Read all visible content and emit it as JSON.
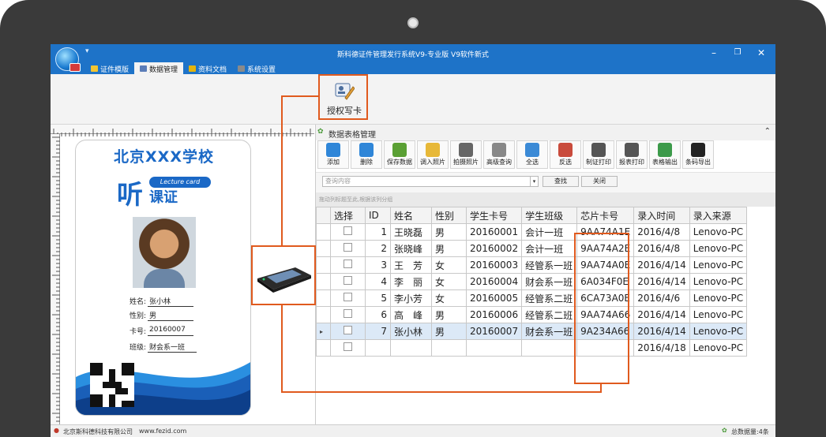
{
  "window": {
    "title": "斯科德证件管理发行系统V9-专业版   V9软件新式",
    "qa": "▾"
  },
  "tabs": [
    {
      "label": "证件模版",
      "color": "#f3c531"
    },
    {
      "label": "数据管理",
      "color": "#5b7db8",
      "active": true
    },
    {
      "label": "资料文档",
      "color": "#e3b40d"
    },
    {
      "label": "系统设置",
      "color": "#8a8a8a"
    }
  ],
  "ribbon": {
    "write_card": "授权写卡"
  },
  "card": {
    "school": "北京XXX学校",
    "ting": "听",
    "kezheng": "课证",
    "lecture": "Lecture card",
    "fields": [
      {
        "label": "姓名:",
        "value": "张小林"
      },
      {
        "label": "性别:",
        "value": "男"
      },
      {
        "label": "卡号:",
        "value": "20160007"
      },
      {
        "label": "班级:",
        "value": "财会系一班"
      }
    ]
  },
  "grid_panel": {
    "title": "数据表格管理"
  },
  "toolbar": [
    {
      "label": "添加",
      "color": "#2f86d8"
    },
    {
      "label": "删除",
      "color": "#2f86d8"
    },
    {
      "label": "保存数据",
      "color": "#5aa034"
    },
    {
      "label": "调入照片",
      "color": "#e7b838"
    },
    {
      "label": "拍摄照片",
      "color": "#666666"
    },
    {
      "label": "高级查询",
      "color": "#888888"
    },
    {
      "label": "全选",
      "color": "#3b8ad6"
    },
    {
      "label": "反选",
      "color": "#c94b3c"
    },
    {
      "label": "制证打印",
      "color": "#555555"
    },
    {
      "label": "报表打印",
      "color": "#555555"
    },
    {
      "label": "表格输出",
      "color": "#3c9a4a"
    },
    {
      "label": "条码导出",
      "color": "#222222"
    }
  ],
  "search": {
    "placeholder": "查询内容",
    "find_label": "查找",
    "close_label": "关闭",
    "group_hint": "拖动列标题至此,根据该列分组"
  },
  "table": {
    "headers": [
      "选择",
      "ID",
      "姓名",
      "性别",
      "学生卡号",
      "学生班级",
      "芯片卡号",
      "录入时间",
      "录入来源"
    ],
    "rows": [
      [
        "",
        "1",
        "王晓磊",
        "男",
        "20160001",
        "会计一班",
        "9AA74A1E",
        "2016/4/8",
        "Lenovo-PC"
      ],
      [
        "",
        "2",
        "张晓峰",
        "男",
        "20160002",
        "会计一班",
        "9AA74A2E",
        "2016/4/8",
        "Lenovo-PC"
      ],
      [
        "",
        "3",
        "王　芳",
        "女",
        "20160003",
        "经管系一班",
        "9AA74A0E",
        "2016/4/14",
        "Lenovo-PC"
      ],
      [
        "",
        "4",
        "李　丽",
        "女",
        "20160004",
        "财会系一班",
        "6A034F0E",
        "2016/4/14",
        "Lenovo-PC"
      ],
      [
        "",
        "5",
        "李小芳",
        "女",
        "20160005",
        "经管系二班",
        "6CA73A0E",
        "2016/4/6",
        "Lenovo-PC"
      ],
      [
        "",
        "6",
        "高　峰",
        "男",
        "20160006",
        "经管系二班",
        "9AA74A66",
        "2016/4/14",
        "Lenovo-PC"
      ],
      [
        "",
        "7",
        "张小林",
        "男",
        "20160007",
        "财会系一班",
        "9A234A66",
        "2016/4/14",
        "Lenovo-PC"
      ],
      [
        "",
        "",
        "",
        "",
        "",
        "",
        "",
        "2016/4/18",
        "Lenovo-PC"
      ]
    ],
    "selected_index": 6
  },
  "status": {
    "company": "北京斯科德科技有限公司",
    "url": "www.fezid.com",
    "total": "总数据量:4条"
  },
  "colors": {
    "title_blue": "#1e73c8",
    "highlight": "#e05a1e",
    "card_blue": "#1a68c6"
  }
}
